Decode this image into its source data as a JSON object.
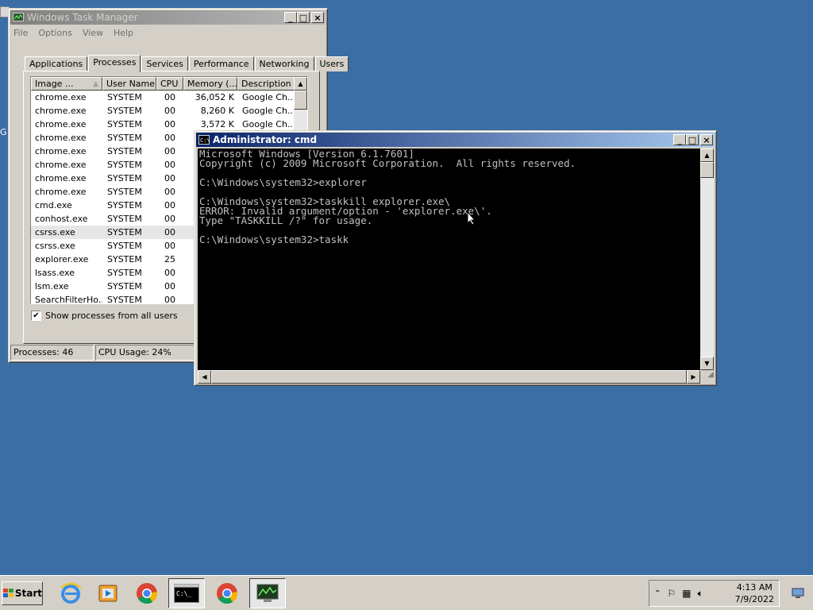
{
  "taskmgr": {
    "title": "Windows Task Manager",
    "menu": [
      "File",
      "Options",
      "View",
      "Help"
    ],
    "tabs": [
      "Applications",
      "Processes",
      "Services",
      "Performance",
      "Networking",
      "Users"
    ],
    "selected_tab": "Processes",
    "columns": [
      "Image ...",
      "User Name",
      "CPU",
      "Memory (...",
      "Description"
    ],
    "rows": [
      {
        "image": "chrome.exe",
        "user": "SYSTEM",
        "cpu": "00",
        "mem": "36,052 K",
        "desc": "Google Ch..."
      },
      {
        "image": "chrome.exe",
        "user": "SYSTEM",
        "cpu": "00",
        "mem": "8,260 K",
        "desc": "Google Ch..."
      },
      {
        "image": "chrome.exe",
        "user": "SYSTEM",
        "cpu": "00",
        "mem": "3,572 K",
        "desc": "Google Ch..."
      },
      {
        "image": "chrome.exe",
        "user": "SYSTEM",
        "cpu": "00",
        "mem": "",
        "desc": ""
      },
      {
        "image": "chrome.exe",
        "user": "SYSTEM",
        "cpu": "00",
        "mem": "",
        "desc": ""
      },
      {
        "image": "chrome.exe",
        "user": "SYSTEM",
        "cpu": "00",
        "mem": "",
        "desc": ""
      },
      {
        "image": "chrome.exe",
        "user": "SYSTEM",
        "cpu": "00",
        "mem": "",
        "desc": ""
      },
      {
        "image": "chrome.exe",
        "user": "SYSTEM",
        "cpu": "00",
        "mem": "",
        "desc": ""
      },
      {
        "image": "cmd.exe",
        "user": "SYSTEM",
        "cpu": "00",
        "mem": "",
        "desc": ""
      },
      {
        "image": "conhost.exe",
        "user": "SYSTEM",
        "cpu": "00",
        "mem": "",
        "desc": ""
      },
      {
        "image": "csrss.exe",
        "user": "SYSTEM",
        "cpu": "00",
        "mem": "",
        "desc": ""
      },
      {
        "image": "csrss.exe",
        "user": "SYSTEM",
        "cpu": "00",
        "mem": "",
        "desc": ""
      },
      {
        "image": "explorer.exe",
        "user": "SYSTEM",
        "cpu": "25",
        "mem": "",
        "desc": ""
      },
      {
        "image": "lsass.exe",
        "user": "SYSTEM",
        "cpu": "00",
        "mem": "",
        "desc": ""
      },
      {
        "image": "lsm.exe",
        "user": "SYSTEM",
        "cpu": "00",
        "mem": "",
        "desc": ""
      },
      {
        "image": "SearchFilterHo...",
        "user": "SYSTEM",
        "cpu": "00",
        "mem": "",
        "desc": ""
      }
    ],
    "selected_row": 10,
    "show_all_label": "Show processes from all users",
    "show_all_checked": true,
    "status_processes": "Processes: 46",
    "status_cpu": "CPU Usage: 24%"
  },
  "cmd": {
    "title": "Administrator: cmd",
    "lines": [
      "Microsoft Windows [Version 6.1.7601]",
      "Copyright (c) 2009 Microsoft Corporation.  All rights reserved.",
      "",
      "C:\\Windows\\system32>explorer",
      "",
      "C:\\Windows\\system32>taskkill explorer.exe\\",
      "ERROR: Invalid argument/option - 'explorer.exe\\'.",
      "Type \"TASKKILL /?\" for usage.",
      "",
      "C:\\Windows\\system32>taskk"
    ]
  },
  "taskbar": {
    "start_label": "Start",
    "apps": [
      "internet-explorer",
      "media-player",
      "chrome",
      "cmd",
      "chrome",
      "task-manager"
    ],
    "clock_time": "4:13 AM",
    "clock_date": "7/9/2022"
  },
  "desktop": {
    "edge_letter": "G"
  }
}
